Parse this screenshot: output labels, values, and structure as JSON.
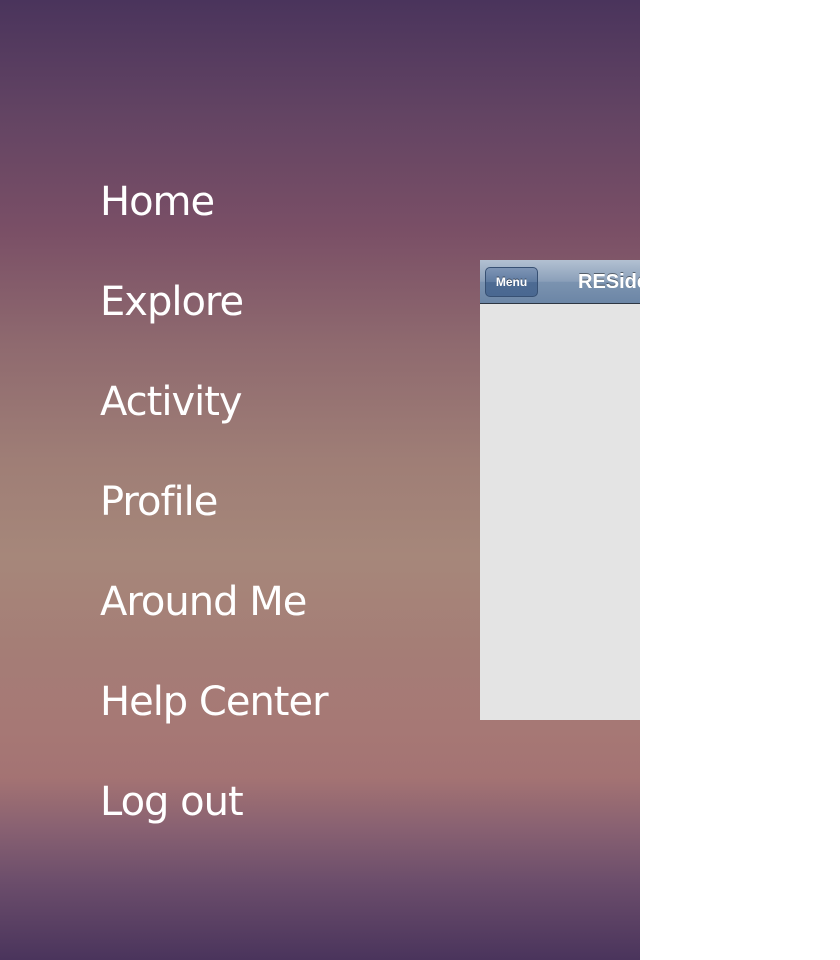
{
  "side_menu": {
    "items": [
      {
        "label": "Home"
      },
      {
        "label": "Explore"
      },
      {
        "label": "Activity"
      },
      {
        "label": "Profile"
      },
      {
        "label": "Around Me"
      },
      {
        "label": "Help Center"
      },
      {
        "label": "Log out"
      }
    ]
  },
  "content_preview": {
    "nav_bar": {
      "menu_button_label": "Menu",
      "title": "RESideMenu"
    }
  },
  "colors": {
    "gradient_top": "#4a345c",
    "gradient_middle": "#a6877a",
    "gradient_bottom": "#4a345c",
    "menu_text": "#ffffff",
    "content_background": "#e4e4e4",
    "nav_bar_blue": "#6c86a6"
  }
}
